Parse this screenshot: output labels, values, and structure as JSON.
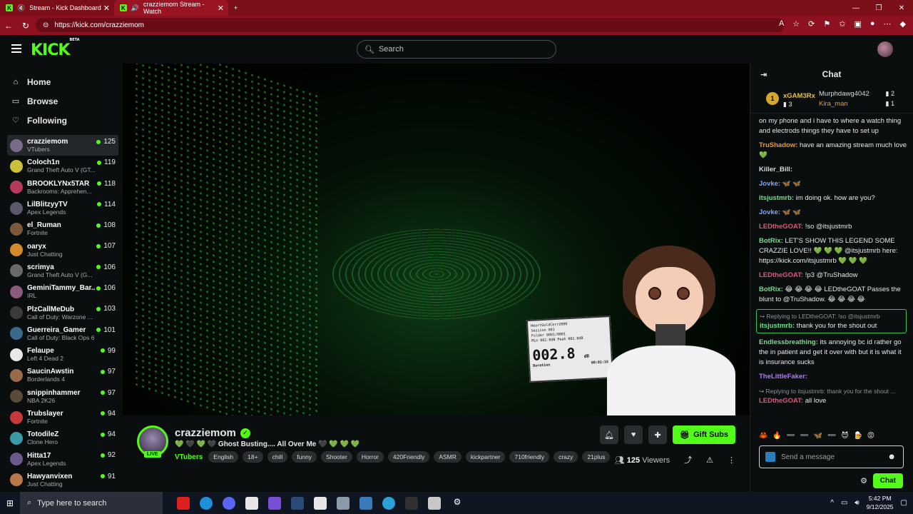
{
  "browser": {
    "tabs": [
      {
        "title": "Stream - Kick Dashboard"
      },
      {
        "title": "crazziemom Stream - Watch"
      }
    ],
    "url": "https://kick.com/crazziemom"
  },
  "topbar": {
    "logo": "KICK",
    "logo_badge": "BETA",
    "search_placeholder": "Search"
  },
  "nav": {
    "home": "Home",
    "browse": "Browse",
    "following": "Following"
  },
  "channels": [
    {
      "name": "crazziemom",
      "category": "VTubers",
      "viewers": "125",
      "color": "#7b6a8c"
    },
    {
      "name": "Coloch1n",
      "category": "Grand Theft Auto V (GT...",
      "viewers": "119",
      "color": "#c9c13a"
    },
    {
      "name": "BROOKLYNx5TAR",
      "category": "Backrooms: Apprehen...",
      "viewers": "118",
      "color": "#b83a5a"
    },
    {
      "name": "LilBlitzyyTV",
      "category": "Apex Legends",
      "viewers": "114",
      "color": "#5a5a6a"
    },
    {
      "name": "el_Ruman",
      "category": "Fortnite",
      "viewers": "108",
      "color": "#7a5a3a"
    },
    {
      "name": "oaryx",
      "category": "Just Chatting",
      "viewers": "107",
      "color": "#d48a2a"
    },
    {
      "name": "scrimya",
      "category": "Grand Theft Auto V (G...",
      "viewers": "106",
      "color": "#6a6a6a"
    },
    {
      "name": "GeminiTammy_Bar...",
      "category": "IRL",
      "viewers": "106",
      "color": "#8a5a7a"
    },
    {
      "name": "PlzCallMeDub",
      "category": "Call of Duty: Warzone ...",
      "viewers": "103",
      "color": "#3a3a3a"
    },
    {
      "name": "Guerreira_Gamer",
      "category": "Call of Duty: Black Ops 6",
      "viewers": "101",
      "color": "#3a6a8a"
    },
    {
      "name": "Felaupe",
      "category": "Left 4 Dead 2",
      "viewers": "99",
      "color": "#e8e8e8"
    },
    {
      "name": "SaucinAwstin",
      "category": "Borderlands 4",
      "viewers": "97",
      "color": "#9a6a4a"
    },
    {
      "name": "snippinhammer",
      "category": "NBA 2K26",
      "viewers": "97",
      "color": "#5a4a3a"
    },
    {
      "name": "Trubslayer",
      "category": "Fortnite",
      "viewers": "94",
      "color": "#c83a3a"
    },
    {
      "name": "TotodileZ",
      "category": "Clone Hero",
      "viewers": "94",
      "color": "#3a9aa8"
    },
    {
      "name": "Hitta17",
      "category": "Apex Legends",
      "viewers": "92",
      "color": "#6a5a8a"
    },
    {
      "name": "Hawyanvixen",
      "category": "Just Chatting",
      "viewers": "91",
      "color": "#b8784a"
    }
  ],
  "video": {
    "device_lines": [
      "HeartGoldCerr2000",
      "Session 001",
      "Folder 0001/0001",
      "Min 002.8dB  Peak 002.8dB"
    ],
    "device_reading": "002.8",
    "device_unit": "dB",
    "device_label": "Duration",
    "device_time": "00:01:18"
  },
  "stream": {
    "username": "crazziemom",
    "live_badge": "LIVE",
    "title": "💚 🖤 💚 🖤 Ghost Busting.... All Over Me 🖤 💚 💚 💚",
    "category": "VTubers",
    "tags": [
      "English",
      "18+",
      "chill",
      "funny",
      "Shooter",
      "Horror",
      "420Friendly",
      "ASMR",
      "kickpartner",
      "710friendly",
      "crazy",
      "21plus"
    ],
    "gift_label": "Gift Subs",
    "viewers": "125",
    "viewers_label": "Viewers"
  },
  "chat": {
    "title": "Chat",
    "gifters": {
      "top_rank": "1",
      "top_name": "xGAM3Rx",
      "top_count": "3",
      "second_name": "Murphdawg4042",
      "second_count": "2",
      "third_name": "Kira_man",
      "third_count": "1"
    },
    "messages": [
      {
        "user": "",
        "text": "on my phone and i have to where a watch thing and electrods things they have to set up",
        "color": "#ffffff",
        "reply": ""
      },
      {
        "user": "TruShadow:",
        "text": "have an amazing stream much love 💚",
        "color": "#e89a3a",
        "reply": ""
      },
      {
        "user": "Killer_Bill:",
        "text": "",
        "color": "#d8dbdd",
        "reply": ""
      },
      {
        "user": "Jovke:",
        "text": "🦋 🦋",
        "color": "#7aa8ff",
        "reply": ""
      },
      {
        "user": "itsjustmrb:",
        "text": "im doing ok. how are you?",
        "color": "#6fe08a",
        "reply": ""
      },
      {
        "user": "Jovke:",
        "text": "🦋 🦋",
        "color": "#7aa8ff",
        "reply": ""
      },
      {
        "user": "LEDtheGOAT:",
        "text": "!so @itsjustmrb",
        "color": "#e0557a",
        "reply": ""
      },
      {
        "user": "BotRix:",
        "text": "LET'S SHOW THIS LEGEND SOME CRAZZIE LOVE!! 💚 💚 💚 @itsjustmrb here: https://kick.com/itsjustmrb 💚 💚 💚",
        "color": "#6fe08a",
        "reply": ""
      },
      {
        "user": "LEDtheGOAT:",
        "text": "!p3 @TruShadow",
        "color": "#e0557a",
        "reply": ""
      },
      {
        "user": "BotRix:",
        "text": "😂 😂 😂 😂 LEDtheGOAT Passes the blunt to @TruShadow. 😂 😂 😂 😂",
        "color": "#6fe08a",
        "reply": ""
      },
      {
        "user": "itsjustmrb:",
        "text": "thank you for the shout out",
        "color": "#6fe08a",
        "reply": "Replying to LEDtheGOAT: !so @itsjustmrb"
      },
      {
        "user": "Endlessbreathing:",
        "text": "its annoying bc id rather go the in patient and get it over with but it is what it is insurance sucks",
        "color": "#6fe08a",
        "reply": ""
      },
      {
        "user": "TheLittleFaker:",
        "text": "",
        "color": "#b07aff",
        "reply": ""
      },
      {
        "user": "LEDtheGOAT:",
        "text": "all love",
        "color": "#e0557a",
        "reply": "Replying to itsjustmrb: thank you for the shout ..."
      }
    ],
    "send_placeholder": "Send a message",
    "chat_button": "Chat"
  },
  "taskbar": {
    "search_placeholder": "Type here to search",
    "time": "5:42 PM",
    "date": "9/12/2025"
  }
}
